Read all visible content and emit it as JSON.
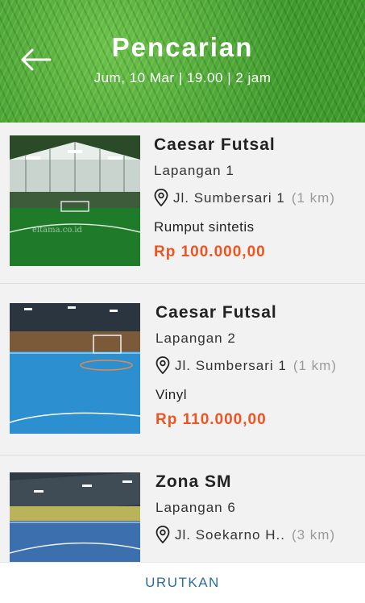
{
  "header": {
    "title": "Pencarian",
    "subtitle": "Jum, 10 Mar | 19.00 | 2 jam"
  },
  "results": [
    {
      "name": "Caesar Futsal",
      "court": "Lapangan 1",
      "address": "Jl. Sumbersari 1",
      "distance": "(1 km)",
      "surface": "Rumput sintetis",
      "price": "Rp 100.000,00",
      "image_alt": "eltama.co.id"
    },
    {
      "name": "Caesar Futsal",
      "court": "Lapangan 2",
      "address": "Jl. Sumbersari 1",
      "distance": "(1 km)",
      "surface": "Vinyl",
      "price": "Rp 110.000,00"
    },
    {
      "name": "Zona SM",
      "court": "Lapangan 6",
      "address": "Jl. Soekarno H..",
      "distance": "(3 km)",
      "surface": "",
      "price": ""
    }
  ],
  "footer": {
    "sort_label": "URUTKAN"
  },
  "colors": {
    "price": "#f0531f",
    "sort": "#2c6e9c",
    "header_grass": "#4fa83a"
  }
}
